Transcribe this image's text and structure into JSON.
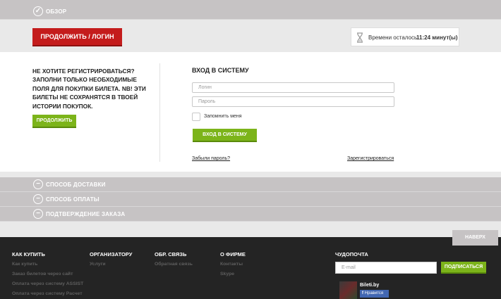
{
  "steps": {
    "overview": "ОБЗОР",
    "delivery": "СПОСОБ ДОСТАВКИ",
    "payment": "СПОСОБ ОПЛАТЫ",
    "confirm": "ПОДТВЕРЖДЕНИЕ ЗАКАЗА"
  },
  "header": {
    "continue_login": "ПРОДОЛЖИТЬ / ЛОГИН",
    "time_left_label": "Времени осталось",
    "time_left_value": "11:24 минут(ы)"
  },
  "guest": {
    "text": "НЕ ХОТИТЕ РЕГИСТРИРОВАТЬСЯ? ЗАПОЛНИ ТОЛЬКО НЕОБХОДИМЫЕ ПОЛЯ ДЛЯ ПОКУПКИ БИЛЕТА. NB! ЭТИ БИЛЕТЫ НЕ СОХРАНЯТСЯ В ТВОЕЙ ИСТОРИИ ПОКУПОК.",
    "continue": "ПРОДОЛЖИТЬ"
  },
  "login": {
    "title": "ВХОД В СИСТЕМУ",
    "login_placeholder": "Логин",
    "password_placeholder": "Пароль",
    "remember": "Запомнить меня",
    "submit": "ВХОД В СИСТЕМУ",
    "forgot": "Забыли пароль?",
    "register": "Зарегистрироваться"
  },
  "footer": {
    "to_top": "НАВЕРХ",
    "how_to_buy": {
      "title": "КАК КУПИТЬ",
      "links": [
        "Как купить",
        "Заказ билетов через сайт",
        "Оплата через систему ASSIST",
        "Оплата через систему Расчет"
      ]
    },
    "organizer": {
      "title": "ОРГАНИЗАТОРУ",
      "links": [
        "Услуги"
      ]
    },
    "feedback": {
      "title": "ОБР. СВЯЗЬ",
      "links": [
        "Обратная связь"
      ]
    },
    "about": {
      "title": "О ФИРМЕ",
      "links": [
        "Контакты",
        "Skype"
      ]
    },
    "newsletter": {
      "title": "ЧУДОПОЧТА",
      "email_placeholder": "E-mail",
      "subscribe": "ПОДПИСАТЬСЯ"
    },
    "social": {
      "page_name": "Bileti.by",
      "like": "Нравится"
    }
  },
  "icons": {
    "check": "check-circle-icon",
    "minus": "minus-circle-icon",
    "timer": "hourglass-icon"
  },
  "colors": {
    "primary_red": "#c41c1c",
    "accent_green": "#7cb41a",
    "step_bar": "#c6c3c4",
    "footer_bg": "#242424"
  }
}
